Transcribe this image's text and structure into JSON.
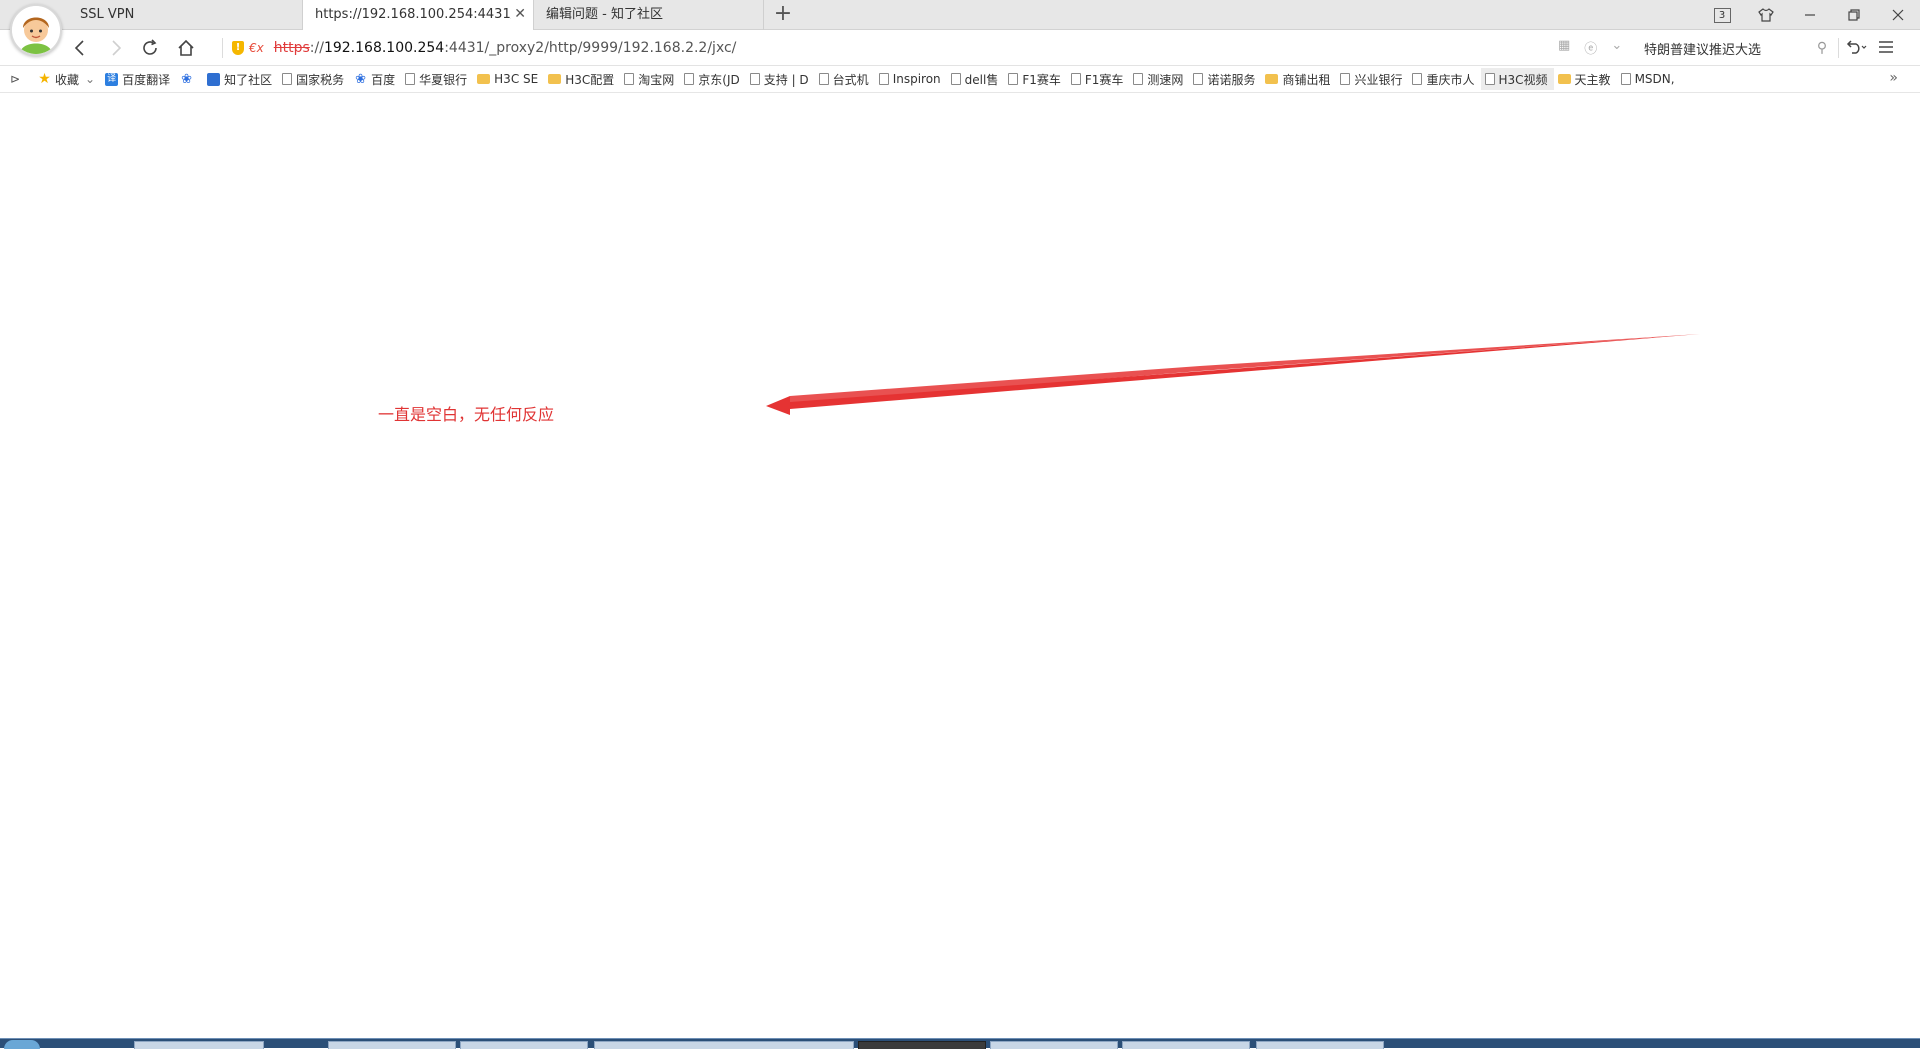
{
  "tabs": [
    {
      "label": "SSL VPN",
      "active": false
    },
    {
      "label": "https://192.168.100.254:4431/_proxy2/http/9999/192.168.2.2/jxc/",
      "active": true
    },
    {
      "label": "编辑问题 - 知了社区",
      "active": false
    }
  ],
  "tab_count": "3",
  "address": {
    "protocol": "https",
    "separator": "://",
    "host": "192.168.100.254",
    "rest": ":4431/_proxy2/http/9999/192.168.2.2/jxc/",
    "security_badge": "!",
    "fx_label": "€x"
  },
  "search": {
    "text": "特朗普建议推迟大选"
  },
  "bookmarks": [
    {
      "label": "收藏",
      "icon": "star-icon"
    },
    {
      "label": "百度翻译",
      "icon": "translate-icon"
    },
    {
      "label": "",
      "icon": "baidu-paw-icon"
    },
    {
      "label": "知了社区",
      "icon": "zhiliao-icon"
    },
    {
      "label": "国家税务",
      "icon": "page-icon"
    },
    {
      "label": "百度",
      "icon": "baidu-paw-icon"
    },
    {
      "label": "华夏银行",
      "icon": "page-icon"
    },
    {
      "label": "H3C SE",
      "icon": "folder-icon"
    },
    {
      "label": "H3C配置",
      "icon": "folder-icon"
    },
    {
      "label": "淘宝网",
      "icon": "page-icon"
    },
    {
      "label": "京东(JD",
      "icon": "page-icon"
    },
    {
      "label": "支持 | D",
      "icon": "page-icon"
    },
    {
      "label": "台式机",
      "icon": "page-icon"
    },
    {
      "label": "Inspiron",
      "icon": "page-icon"
    },
    {
      "label": "dell售",
      "icon": "page-icon"
    },
    {
      "label": "F1赛车",
      "icon": "page-icon"
    },
    {
      "label": "F1赛车",
      "icon": "page-icon"
    },
    {
      "label": "测速网",
      "icon": "page-icon"
    },
    {
      "label": "诺诺服务",
      "icon": "page-icon"
    },
    {
      "label": "商铺出租",
      "icon": "folder-icon"
    },
    {
      "label": "兴业银行",
      "icon": "page-icon"
    },
    {
      "label": "重庆市人",
      "icon": "page-icon"
    },
    {
      "label": "H3C视频",
      "icon": "page-icon"
    },
    {
      "label": "天主教",
      "icon": "folder-icon"
    },
    {
      "label": "MSDN,",
      "icon": "page-icon"
    }
  ],
  "annotation": {
    "text": "一直是空白，无任何反应",
    "color": "#e03434"
  }
}
